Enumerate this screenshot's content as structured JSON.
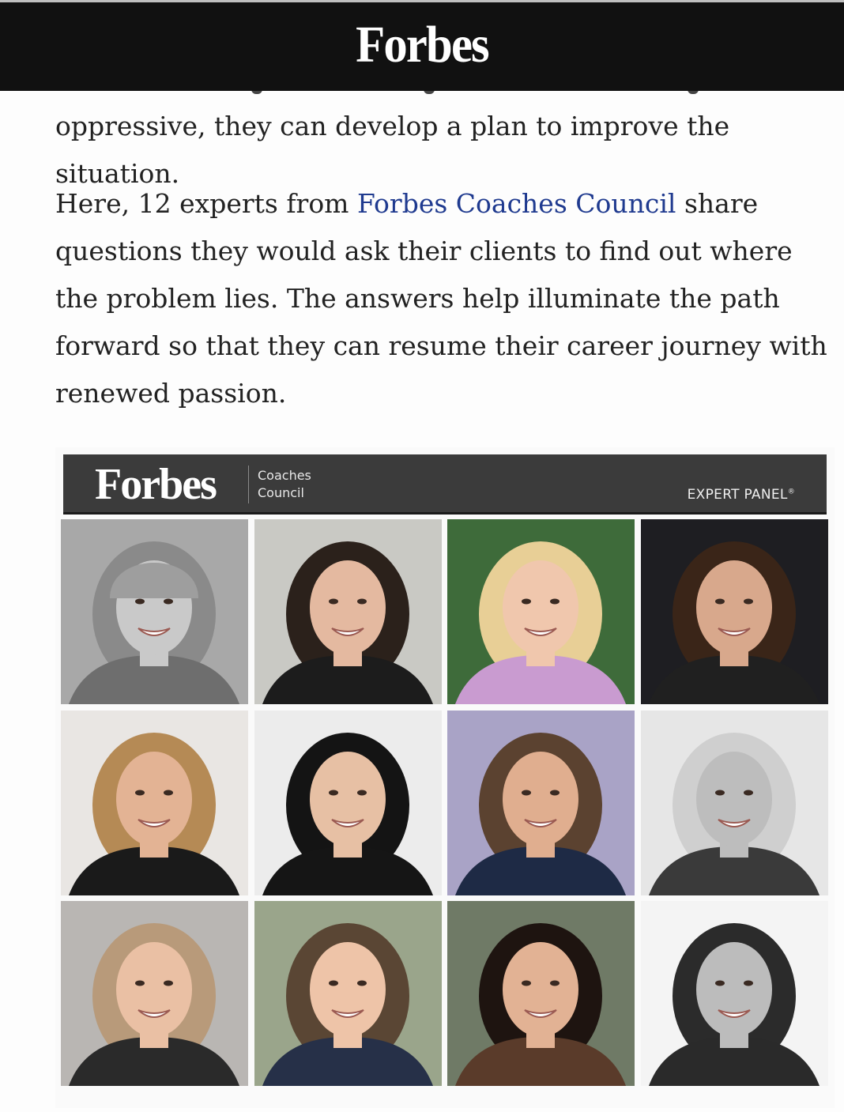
{
  "header": {
    "logo_text": "Forbes"
  },
  "article": {
    "paragraph1": "oppressive, they can develop a plan to improve the situation.",
    "paragraph2_before": "Here, 12 experts from ",
    "paragraph2_link": "Forbes Coaches Council",
    "paragraph2_after": " share questions they would ask their clients to find out where the problem lies. The answers help illuminate the path forward so that they can resume their career journey with renewed passion."
  },
  "panel_image": {
    "logo_text": "Forbes",
    "council_line1": "Coaches",
    "council_line2": "Council",
    "expert_panel_label": "EXPERT PANEL",
    "registered_mark": "®",
    "photos": [
      {
        "bg": "#a8a8a8",
        "hair": "#8a8a8a",
        "skin": "#c9c9c9",
        "shirt": "#6e6e6e",
        "hat": "#9e9e9e"
      },
      {
        "bg": "#c9c9c4",
        "hair": "#2b211b",
        "skin": "#e4b9a0",
        "shirt": "#1c1c1c",
        "hat": ""
      },
      {
        "bg": "#3e6b3a",
        "hair": "#e8cf96",
        "skin": "#f0c7ad",
        "shirt": "#c99bd0",
        "hat": ""
      },
      {
        "bg": "#1e1e22",
        "hair": "#3a2518",
        "skin": "#d8a88c",
        "shirt": "#202020",
        "hat": ""
      },
      {
        "bg": "#e9e6e3",
        "hair": "#b58a55",
        "skin": "#e3b394",
        "shirt": "#1a1a1a",
        "hat": ""
      },
      {
        "bg": "#ececec",
        "hair": "#141414",
        "skin": "#e7c0a4",
        "shirt": "#151515",
        "hat": ""
      },
      {
        "bg": "#a9a3c6",
        "hair": "#5b4230",
        "skin": "#e0ae8f",
        "shirt": "#1e2a45",
        "hat": ""
      },
      {
        "bg": "#e6e6e6",
        "hair": "#cfcfcf",
        "skin": "#bdbdbd",
        "shirt": "#3a3a3a",
        "hat": ""
      },
      {
        "bg": "#b9b6b3",
        "hair": "#b89a7a",
        "skin": "#eac0a4",
        "shirt": "#2a2a2a",
        "hat": ""
      },
      {
        "bg": "#9aa58b",
        "hair": "#5a4634",
        "skin": "#eec4a8",
        "shirt": "#263048",
        "hat": ""
      },
      {
        "bg": "#6f7a66",
        "hair": "#1e1410",
        "skin": "#e2b294",
        "shirt": "#5a3b2a",
        "hat": ""
      },
      {
        "bg": "#f4f4f4",
        "hair": "#2b2b2b",
        "skin": "#bcbcbc",
        "shirt": "#2a2a2a",
        "hat": ""
      }
    ]
  }
}
